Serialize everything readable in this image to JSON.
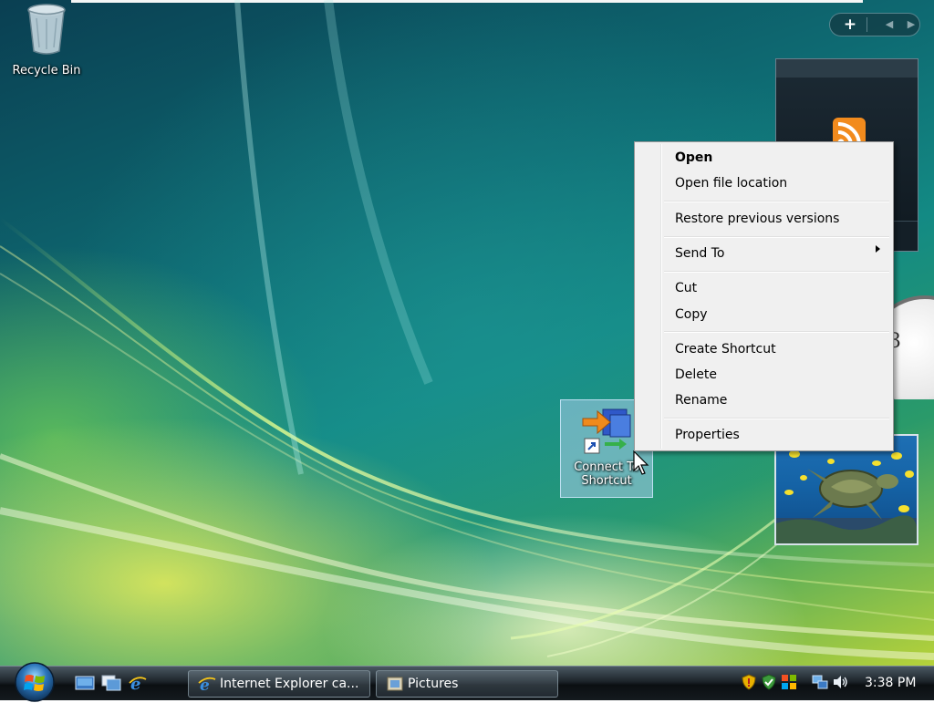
{
  "desktop": {
    "icons": [
      {
        "label": "Recycle Bin"
      },
      {
        "label_line1": "Connect To",
        "label_line2": "Shortcut"
      }
    ]
  },
  "context_menu": {
    "items": [
      {
        "label": "Open"
      },
      {
        "label": "Open file location"
      },
      {
        "label": "Restore previous versions"
      },
      {
        "label": "Send To"
      },
      {
        "label": "Cut"
      },
      {
        "label": "Copy"
      },
      {
        "label": "Create Shortcut"
      },
      {
        "label": "Delete"
      },
      {
        "label": "Rename"
      },
      {
        "label": "Properties"
      }
    ]
  },
  "gadgets": {
    "clock_numeral": "3"
  },
  "taskbar": {
    "tasks": [
      {
        "label": "Internet Explorer ca..."
      },
      {
        "label": "Pictures"
      }
    ],
    "clock": "3:38 PM"
  },
  "colors": {
    "menu_background": "#f0f0f0",
    "taskbar": "#1c2329",
    "selection": "#aacdeb"
  }
}
